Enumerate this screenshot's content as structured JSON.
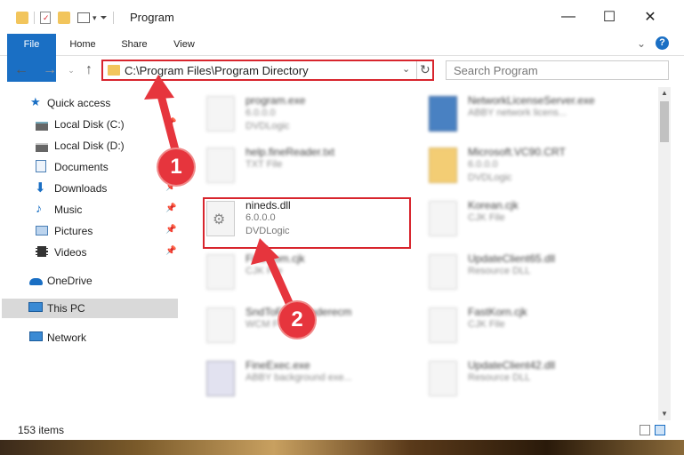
{
  "window": {
    "title": "Program",
    "controls": {
      "minimize": "—",
      "maximize": "☐",
      "close": "✕"
    }
  },
  "ribbon": {
    "tabs": [
      {
        "label": "File",
        "active": true
      },
      {
        "label": "Home"
      },
      {
        "label": "Share"
      },
      {
        "label": "View"
      }
    ],
    "help_icon": "?"
  },
  "address_bar": {
    "path": "C:\\Program Files\\Program Directory",
    "search_placeholder": "Search Program"
  },
  "nav_pane": {
    "items": [
      {
        "label": "Quick access",
        "icon": "star-icon"
      },
      {
        "label": "Local Disk (C:)",
        "icon": "drive-icon",
        "pinned": true
      },
      {
        "label": "Local Disk (D:)",
        "icon": "drive-icon"
      },
      {
        "label": "Documents",
        "icon": "documents-icon",
        "pinned": true
      },
      {
        "label": "Downloads",
        "icon": "download-icon",
        "pinned": true
      },
      {
        "label": "Music",
        "icon": "music-icon",
        "pinned": true
      },
      {
        "label": "Pictures",
        "icon": "pictures-icon",
        "pinned": true
      },
      {
        "label": "Videos",
        "icon": "videos-icon",
        "pinned": true
      },
      {
        "label": "OneDrive",
        "icon": "cloud-icon"
      },
      {
        "label": "This PC",
        "icon": "computer-icon",
        "selected": true
      },
      {
        "label": "Network",
        "icon": "network-icon"
      }
    ]
  },
  "files": [
    {
      "name": "program.exe",
      "line2": "6.0.0.0",
      "line3": "DVDLogic"
    },
    {
      "name": "NetworkLicenseServer.exe",
      "line2": "ABBY network licens...",
      "line3": ""
    },
    {
      "name": "help.fineReader.txt",
      "line2": "TXT File",
      "line3": ""
    },
    {
      "name": "Microsoft.VC90.CRT",
      "line2": "6.0.0.0",
      "line3": "DVDLogic"
    },
    {
      "name": "nineds.dll",
      "line2": "6.0.0.0",
      "line3": "DVDLogic"
    },
    {
      "name": "Korean.cjk",
      "line2": "CJK File",
      "line3": ""
    },
    {
      "name": "FineCom.cjk",
      "line2": "CJK File",
      "line3": ""
    },
    {
      "name": "UpdateClient65.dll",
      "line2": "Resource DLL",
      "line3": ""
    },
    {
      "name": "SndToFineReaderecm",
      "line2": "WCM File",
      "line3": ""
    },
    {
      "name": "FastKorn.cjk",
      "line2": "CJK File",
      "line3": ""
    },
    {
      "name": "FineExec.exe",
      "line2": "ABBY background exe...",
      "line3": ""
    },
    {
      "name": "UpdateClient42.dll",
      "line2": "Resource DLL",
      "line3": ""
    }
  ],
  "status": {
    "item_count": "153 items"
  },
  "annotations": {
    "step1": "1",
    "step2": "2"
  },
  "colors": {
    "accent": "#1a6fc4",
    "highlight": "#d8252d",
    "badge": "#e6353d"
  }
}
